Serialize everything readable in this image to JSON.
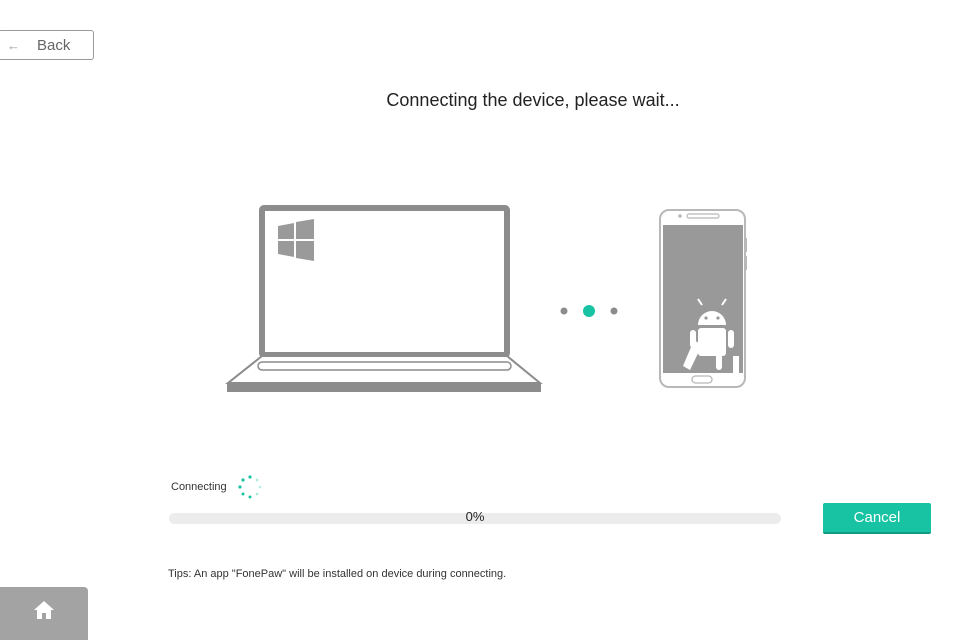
{
  "header": {
    "back_label": "Back",
    "back_icon": "arrow-left-icon"
  },
  "main": {
    "title": "Connecting the device, please wait...",
    "illustration": {
      "computer_icon": "windows-laptop-icon",
      "device_icon": "android-phone-icon",
      "connection_dots": 3,
      "active_dot_index": 1
    }
  },
  "status": {
    "text": "Connecting",
    "spinner_icon": "loading-spinner-icon"
  },
  "progress": {
    "value_fraction": 0,
    "label": "0%"
  },
  "actions": {
    "cancel_label": "Cancel"
  },
  "tips": {
    "text": "Tips: An app \"FonePaw\" will be installed on device during connecting."
  },
  "footer": {
    "home_icon": "home-icon"
  },
  "colors": {
    "accent": "#18c3a3",
    "illustration_gray": "#8c8c8c",
    "track": "#ececec"
  }
}
